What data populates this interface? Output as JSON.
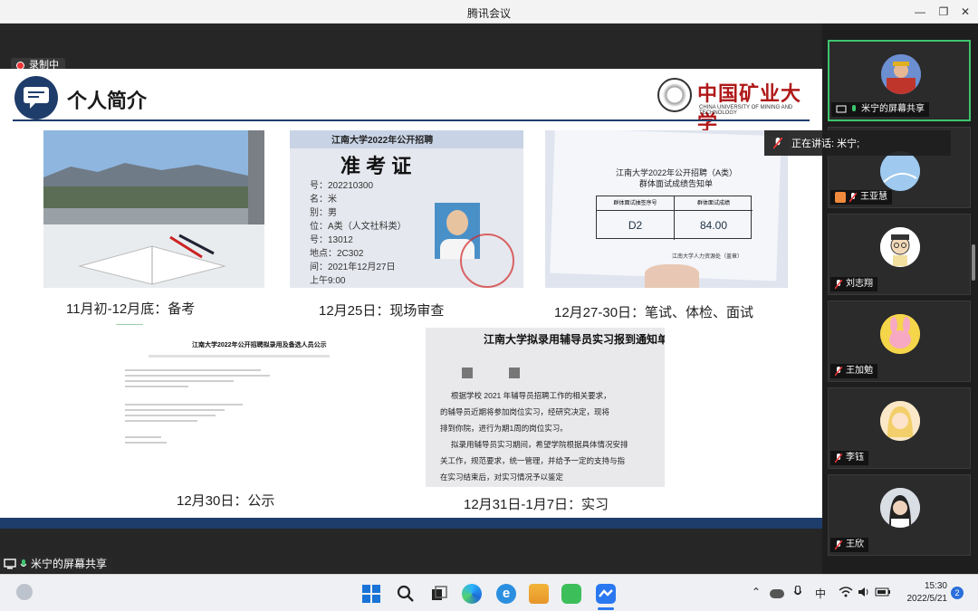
{
  "window": {
    "title": "腾讯会议"
  },
  "recording": {
    "label": "录制中"
  },
  "slide": {
    "title": "个人简介",
    "logo_cn": "中国矿业大学",
    "logo_en": "CHINA UNIVERSITY OF MINING AND TECHNOLOGY",
    "photos": [
      {
        "caption": "11月初-12月底：备考"
      },
      {
        "caption": "12月25日：现场审查",
        "doc_title": "江南大学2022年公开招聘",
        "doc_heading": "准 考 证",
        "doc_lines": [
          "号：202210300",
          "名：米",
          "别：男",
          "位：A类（人文社科类）",
          "号：13012",
          "地点：2C302",
          "间：2021年12月27日",
          "上午9:00"
        ]
      },
      {
        "caption": "12月27-30日：笔试、体检、面试",
        "doc_title": "江南大学2022年公开招聘（A类）",
        "doc_sub": "群体面试成绩告知单",
        "col1": "群体面试抽签序号",
        "col2": "群体面试成绩",
        "val1": "D2",
        "val2": "84.00",
        "footer": "江南大学人力资源处（盖章）"
      },
      {
        "caption": "12月30日：公示",
        "doc_title": "江南大学2022年公开招聘拟录用及备选人员公示"
      },
      {
        "caption": "12月31日-1月7日：实习",
        "doc_title": "江南大学拟录用辅导员实习报到通知单",
        "doc_lines": [
          "根据学校 2021 年辅导员招聘工作的相关要求，",
          "的辅导员近期将参加岗位实习，经研究决定，现将",
          "排到你院，进行为期1周的岗位实习。",
          "拟录用辅导员实习期间，希望学院根据具体情况安排",
          "关工作，规范要求，统一管理，并给予一定的支持与指",
          "在实习结束后，对实习情况予以鉴定"
        ]
      }
    ]
  },
  "share_label": "米宁的屏幕共享",
  "speaking": "正在讲话: 米宁;",
  "participants": [
    {
      "name": "米宁的屏幕共享",
      "active": true
    },
    {
      "name": "王亚慧"
    },
    {
      "name": "刘志翔"
    },
    {
      "name": "王加勉"
    },
    {
      "name": "李钰"
    },
    {
      "name": "王欣"
    }
  ],
  "taskbar": {
    "ime": "中",
    "time": "15:30",
    "date": "2022/5/21",
    "notifications": "2"
  }
}
